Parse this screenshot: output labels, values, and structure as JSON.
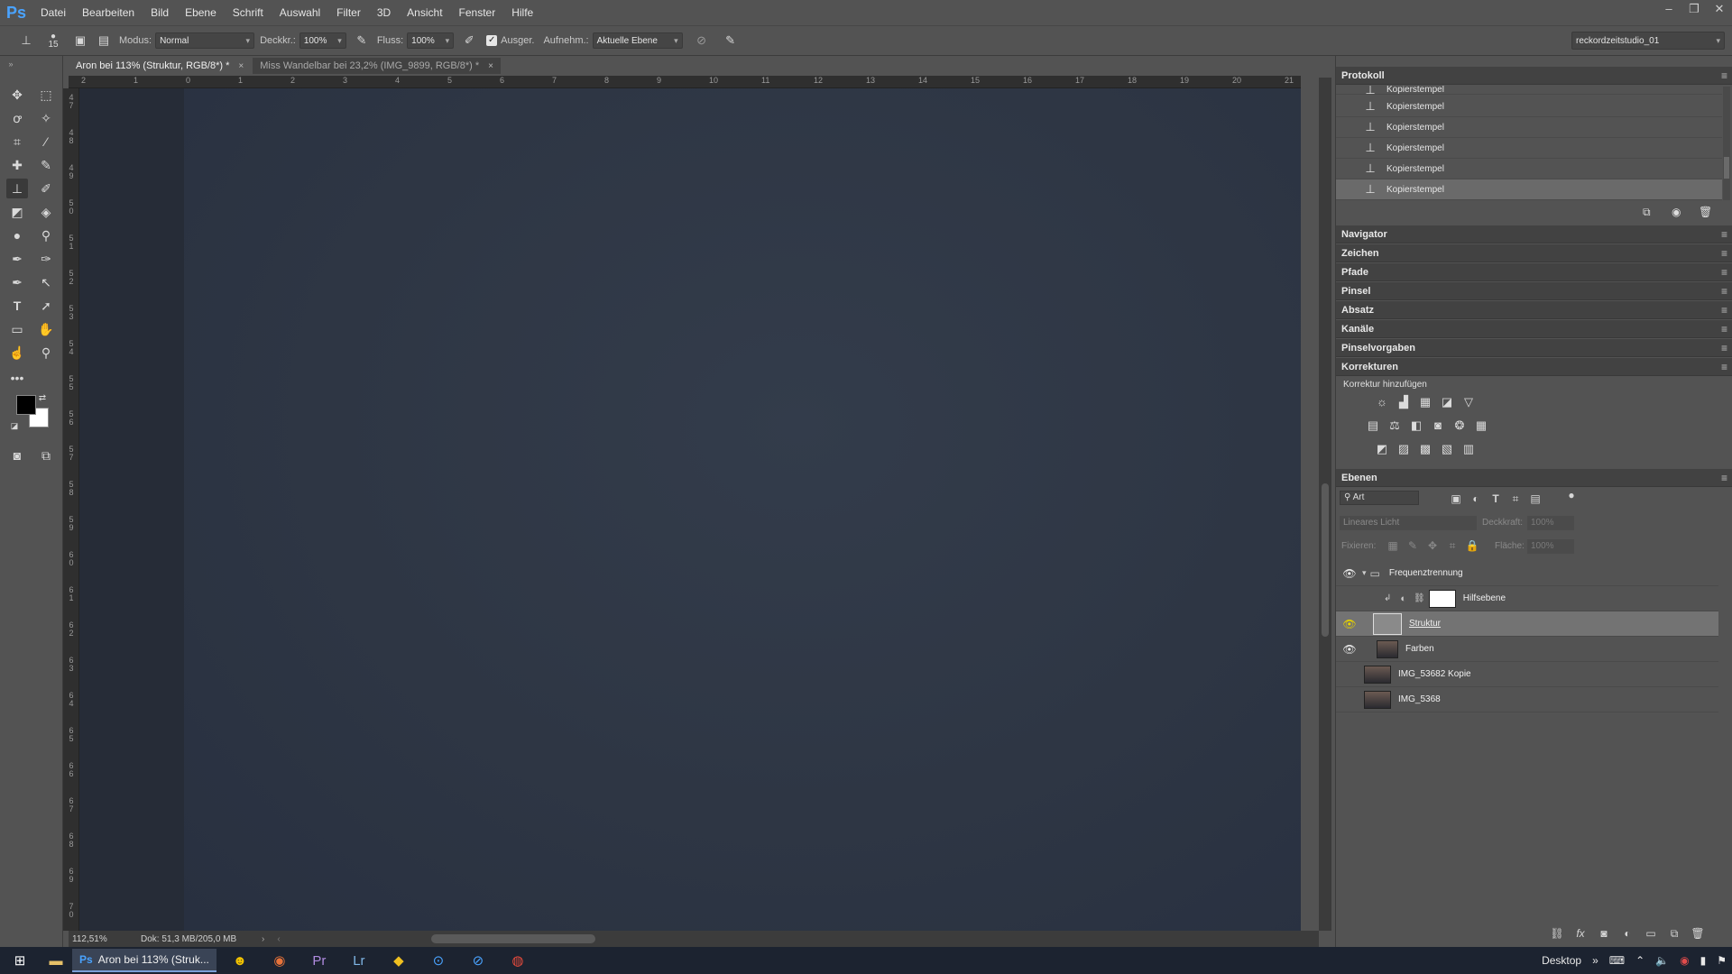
{
  "app": {
    "logo": "Ps"
  },
  "menu": [
    "Datei",
    "Bearbeiten",
    "Bild",
    "Ebene",
    "Schrift",
    "Auswahl",
    "Filter",
    "3D",
    "Ansicht",
    "Fenster",
    "Hilfe"
  ],
  "options": {
    "brush_size": "15",
    "mode_label": "Modus:",
    "mode_value": "Normal",
    "opacity_label": "Deckkr.:",
    "opacity_value": "100%",
    "flow_label": "Fluss:",
    "flow_value": "100%",
    "aligned_label": "Ausger.",
    "sample_label": "Aufnehm.:",
    "sample_value": "Aktuelle Ebene",
    "workspace": "reckordzeitstudio_01"
  },
  "tabs": [
    {
      "label": "Aron bei 113% (Struktur, RGB/8*) *",
      "close": "×"
    },
    {
      "label": "Miss Wandelbar bei 23,2% (IMG_9899, RGB/8*) *",
      "close": "×"
    }
  ],
  "ruler_top": [
    "2",
    "1",
    "0",
    "1",
    "2",
    "3",
    "4",
    "5",
    "6",
    "7",
    "8",
    "9",
    "10",
    "11",
    "12",
    "13",
    "14",
    "15",
    "16",
    "17",
    "18",
    "19",
    "20",
    "21"
  ],
  "ruler_left": [
    "4 7",
    "4 8",
    "4 9",
    "5 0",
    "5 1",
    "5 2",
    "5 3",
    "5 4",
    "5 5",
    "5 6",
    "5 7",
    "5 8",
    "5 9",
    "6 0",
    "6 1",
    "6 2",
    "6 3",
    "6 4",
    "6 5",
    "6 6",
    "6 7",
    "6 8",
    "6 9",
    "7 0"
  ],
  "status": {
    "zoom": "112,51%",
    "doc": "Dok: 51,3 MB/205,0 MB"
  },
  "panels": {
    "history_title": "Protokoll",
    "history_items": [
      "Kopierstempel",
      "Kopierstempel",
      "Kopierstempel",
      "Kopierstempel",
      "Kopierstempel",
      "Kopierstempel"
    ],
    "collapsed": [
      "Navigator",
      "Zeichen",
      "Pfade",
      "Pinsel",
      "Absatz",
      "Kanäle",
      "Pinselvorgaben",
      "Korrekturen"
    ],
    "adjust_label": "Korrektur hinzufügen",
    "layers_title": "Ebenen",
    "filter_kind": "Art",
    "blend_mode": "Lineares Licht",
    "opacity_label": "Deckkraft:",
    "opacity_value": "100%",
    "lock_label": "Fixieren:",
    "fill_label": "Fläche:",
    "fill_value": "100%",
    "layers": [
      {
        "name": "Frequenztrennung",
        "visible": true
      },
      {
        "name": "Hilfsebene",
        "visible": false
      },
      {
        "name": "Struktur",
        "visible": true
      },
      {
        "name": "Farben",
        "visible": true
      },
      {
        "name": "IMG_53682 Kopie",
        "visible": false
      },
      {
        "name": "IMG_5368",
        "visible": false
      }
    ]
  },
  "taskbar": {
    "active_task": "Aron bei 113% (Struk...",
    "desktop": "Desktop"
  }
}
